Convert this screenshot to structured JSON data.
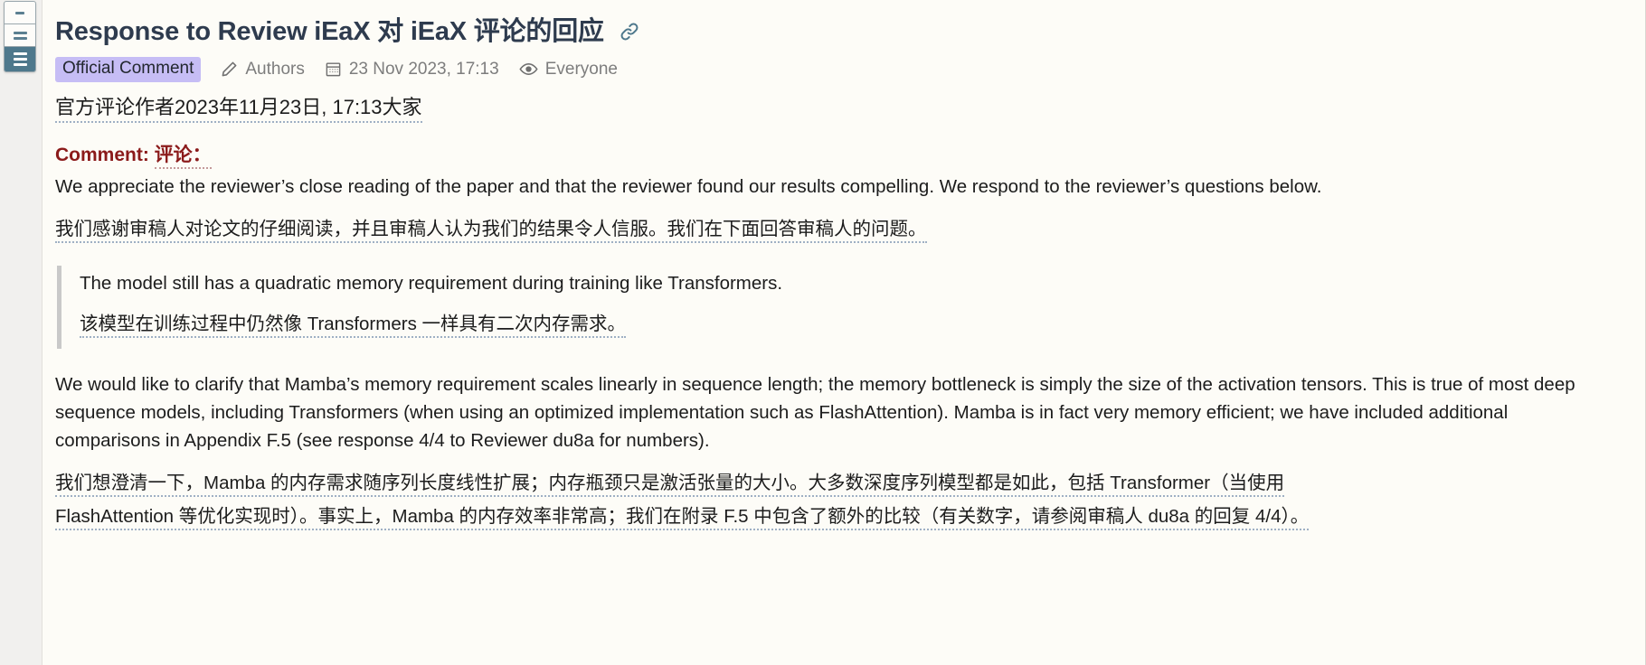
{
  "toolbar": {
    "buttons": [
      {
        "name": "collapse-view-button",
        "icon": "single-line-icon",
        "lines": 1
      },
      {
        "name": "two-line-view-button",
        "icon": "two-lines-icon",
        "lines": 2
      },
      {
        "name": "three-line-view-button",
        "icon": "three-lines-icon",
        "lines": 3,
        "active": true
      }
    ]
  },
  "header": {
    "title": "Response to Review iEaX 对 iEaX 评论的回应",
    "link_icon": "chain-link-icon",
    "badge": "Official Comment",
    "authors_icon": "pencil-icon",
    "authors": "Authors",
    "date_icon": "calendar-icon",
    "date": "23 Nov 2023, 17:13",
    "visibility_icon": "eye-icon",
    "visibility": "Everyone",
    "translation": "官方评论作者2023年11月23日, 17:13大家"
  },
  "content": {
    "comment_label_en": "Comment:",
    "comment_label_cn": "评论：",
    "paragraph1_en": "We appreciate the reviewer’s close reading of the paper and that the reviewer found our results compelling. We respond to the reviewer’s questions below.",
    "paragraph1_cn": "我们感谢审稿人对论文的仔细阅读，并且审稿人认为我们的结果令人信服。我们在下面回答审稿人的问题。",
    "quote_en": "The model still has a quadratic memory requirement during training like Transformers.",
    "quote_cn": "该模型在训练过程中仍然像 Transformers 一样具有二次内存需求。",
    "paragraph2_en": "We would like to clarify that Mamba’s memory requirement scales linearly in sequence length; the memory bottleneck is simply the size of the activation tensors. This is true of most deep sequence models, including Transformers (when using an optimized implementation such as FlashAttention). Mamba is in fact very memory efficient; we have included additional comparisons in Appendix F.5 (see response 4/4 to Reviewer du8a for numbers).",
    "paragraph2_cn_line1": "我们想澄清一下，Mamba 的内存需求随序列长度线性扩展；内存瓶颈只是激活张量的大小。大多数深度序列模型都是如此，包括 Transformer（当使用",
    "paragraph2_cn_line2": "FlashAttention 等优化实现时）。事实上，Mamba 的内存效率非常高；我们在附录 F.5 中包含了额外的比较（有关数字，请参阅审稿人 du8a 的回复 4/4）。"
  },
  "colors": {
    "page_background": "#f1f0ee",
    "card_background": "#fdfcf7",
    "title": "#2e3b4e",
    "badge_background": "#c6bdf5",
    "comment_heading": "#8b1a1a",
    "meta_text": "#7d7d7d",
    "toolbar_active": "#4e788c",
    "quote_border": "#c9c9c9",
    "translation_underline": "#9fb0c4"
  }
}
